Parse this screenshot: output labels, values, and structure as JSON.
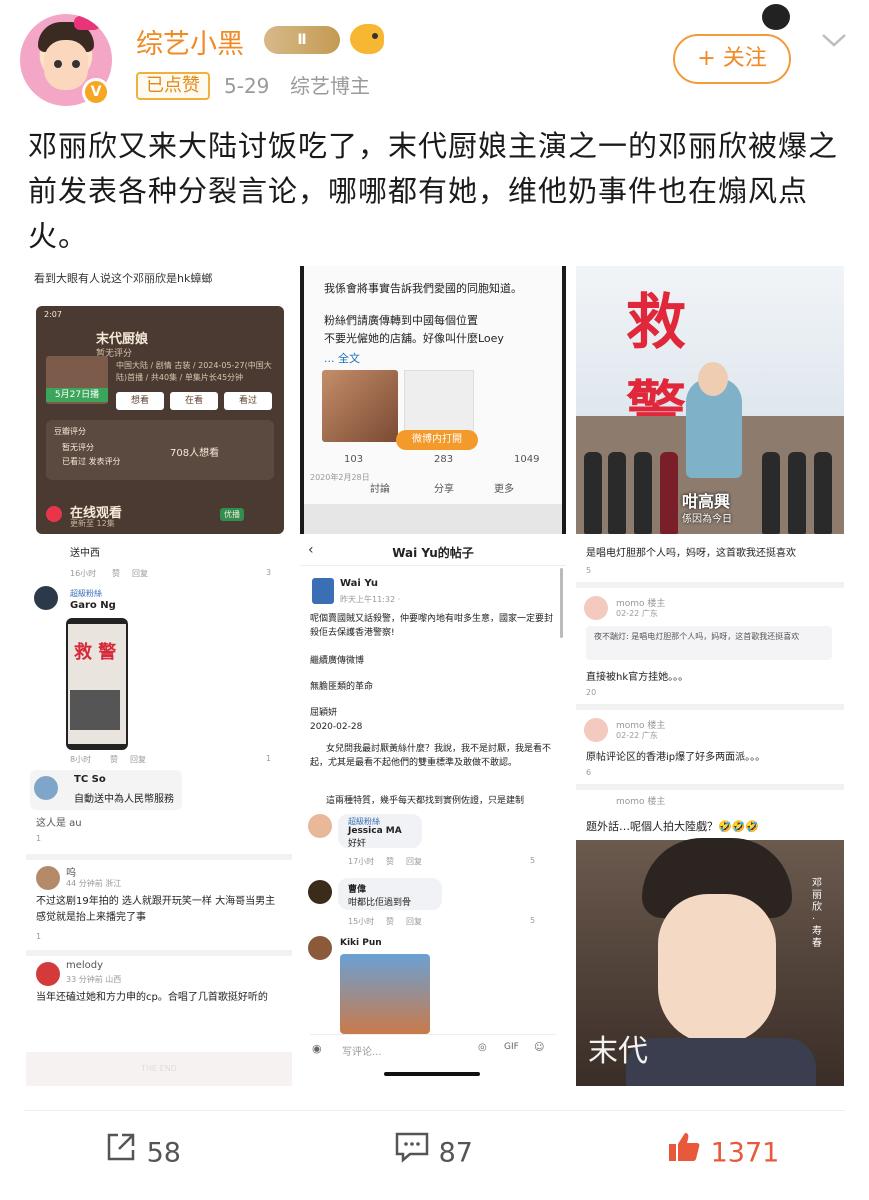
{
  "header": {
    "username": "综艺小黑",
    "level_badge": "Ⅱ",
    "liked_badge": "已点赞",
    "date": "5-29",
    "role": "综艺博主",
    "follow_label": "+ 关注",
    "verified": "V"
  },
  "post": {
    "text": "邓丽欣又来大陆讨饭吃了，末代厨娘主演之一的邓丽欣被爆之前发表各种分裂言论，哪哪都有她，维他奶事件也在煽风点火。"
  },
  "images": {
    "img1": {
      "caption": "看到大眼有人说这个邓丽欣是hk蟑螂",
      "status_time": "2:07",
      "title": "末代厨娘",
      "rating_note": "暂无评分",
      "info": "中国大陆 / 剧情 古装 / 2024-05-27(中国大陆)首播 / 共40集 / 单集片长45分钟",
      "poster_date": "5月27日播",
      "btn_want": "想看",
      "btn_watching": "在看",
      "btn_watched": "看过",
      "score_title": "豆瓣评分",
      "score_none": "暂无评分",
      "score_cta1": "已看过",
      "score_cta2": "发表评分",
      "want_count": "708人想看",
      "online": "在线观看",
      "online_sub": "更新至 12集",
      "platform": "优播"
    },
    "img2": {
      "line1": "我係會將事實告訴我們愛國的同胞知道。",
      "line2": "粉絲們請廣傳轉到中國每個位置",
      "line3": "不要光僱她的店舖。好像叫什麼Loey",
      "more": "... 全文",
      "btn": "微博内打開",
      "repost": "103",
      "comment": "283",
      "like": "1049",
      "act_discuss": "討論",
      "act_share": "分享",
      "act_more": "更多",
      "date": "2020年2月28日"
    },
    "img3": {
      "logo": "救 警",
      "caption": "咁高興",
      "caption2": "係因為今日"
    },
    "img4": {
      "c0_text": "送中西",
      "c0_time": "16小时",
      "c0_like": "赞",
      "c0_reply": "回复",
      "c0_count": "3",
      "garo_tag": "超級粉絲",
      "garo_name": "Garo Ng",
      "c1_time": "8小时",
      "c1_like": "赞",
      "c1_reply": "回复",
      "c1_count": "1",
      "tc_name": "TC So",
      "tc_text": "自動送中為人民幣服務",
      "c_cut": "这人是 au",
      "c2_like": "1",
      "w_name": "呜",
      "w_meta": "44 分钟前 浙江",
      "w_text": "不过这剧19年拍的 选人就跟开玩笑一样 大海哥当男主 感觉就是抬上来播完了事",
      "w_like": "1",
      "m_name": "melody",
      "m_meta": "33 分钟前 山西",
      "m_text": "当年还磕过她和方力申的cp。合唱了几首歌挺好听的",
      "end": "THE END"
    },
    "img5": {
      "title": "Wai Yu的帖子",
      "name": "Wai Yu",
      "meta": "昨天上午11:32 · ",
      "p1": "呢個賣國賊又話殺警，仲要嚟內地有咁多生意，國家一定要封殺佢去保護香港警察!",
      "p2": "繼續廣傳微博",
      "p3": "無膽匪類的革命",
      "p4": "屈穎妍",
      "p5": "2020-02-28",
      "p6": "女兒問我最討厭黃絲什麼？我說，我不是討厭，我是看不起，尤其是最看不起他們的雙重標準及敢做不敢認。",
      "p7": "這兩種特質，幾乎每天都找到實例佐證，只是建制",
      "j_tag": "超級粉絲",
      "j_name": "Jessica MA",
      "j_text": "好奸",
      "j_time": "17小时",
      "j_like": "赞",
      "j_reply": "回复",
      "j_count": "5",
      "z_name": "曹偉",
      "z_text": "咁都比佢過到骨",
      "z_time": "15小时",
      "z_like": "赞",
      "z_reply": "回复",
      "z_count": "5",
      "k_name": "Kiki Pun",
      "input_placeholder": "写评论..."
    },
    "img6": {
      "c0_text": "是唱电灯胆那个人吗，妈呀，这首歌我还挺喜欢",
      "c0_like": "5",
      "momo1_name": "momo",
      "momo1_tag": "楼主",
      "momo1_meta": "02-22 广东",
      "momo1_quote_name": "夜不踹灯",
      "momo1_quote": "是唱电灯胆那个人吗，妈呀，这首歌我还挺喜欢",
      "momo1_text": "直接被hk官方挂她。。。",
      "momo1_like": "20",
      "momo2_name": "momo",
      "momo2_tag": "楼主",
      "momo2_meta": "02-22 广东",
      "momo2_text": "原帖评论区的香港ip爆了好多两面派。。。",
      "momo2_like": "6",
      "momo3_name": "momo",
      "momo3_tag": "楼主",
      "title": "题外話…呢個人拍大陸戲？🤣🤣🤣",
      "big": "末代",
      "side": "邓丽欣 · 寿春"
    }
  },
  "footer": {
    "share_count": "58",
    "comment_count": "87",
    "like_count": "1371"
  },
  "colors": {
    "accent": "#f08a24",
    "like": "#e8583a",
    "meta": "#9a9a9a"
  }
}
